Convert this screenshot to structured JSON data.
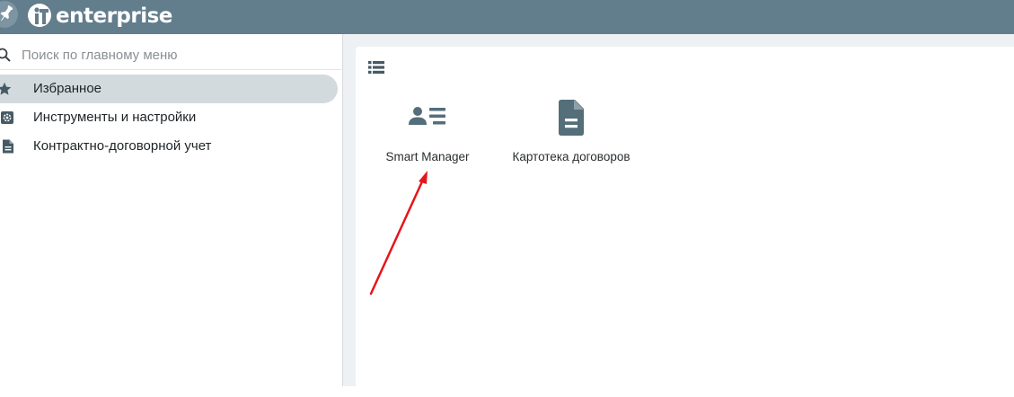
{
  "app": {
    "logo_text": "enterprise"
  },
  "sidebar": {
    "search_placeholder": "Поиск по главному меню",
    "items": [
      {
        "label": "Избранное",
        "icon": "star-icon",
        "active": true
      },
      {
        "label": "Инструменты и настройки",
        "icon": "gear-icon",
        "active": false
      },
      {
        "label": "Контрактно-договорной учет",
        "icon": "document-icon",
        "active": false
      }
    ]
  },
  "main": {
    "view_toggle_icon": "list-view-icon",
    "tiles": [
      {
        "label": "Smart Manager",
        "icon": "contact-card-icon"
      },
      {
        "label": "Картотека договоров",
        "icon": "document-icon"
      }
    ]
  },
  "colors": {
    "topbar": "#627d8b",
    "icon": "#546e7a",
    "active_item": "#d2dade",
    "annotation_arrow": "#e8141b"
  }
}
